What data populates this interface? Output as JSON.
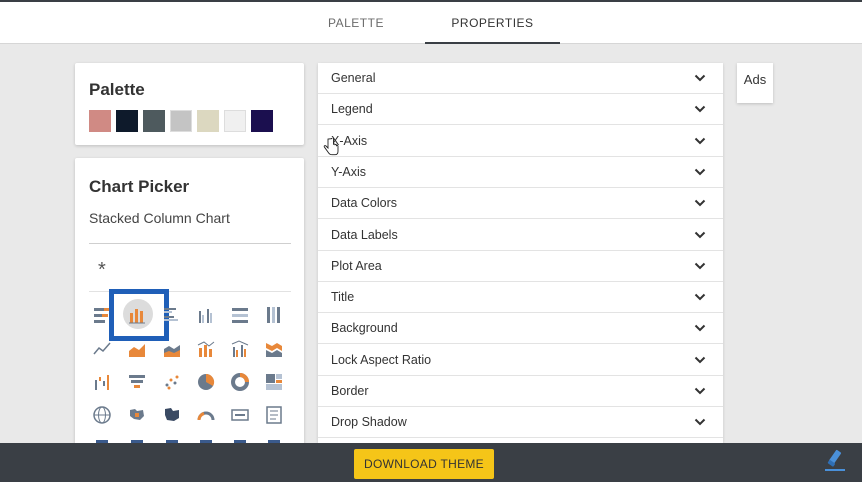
{
  "tabs": [
    {
      "label": "PALETTE",
      "active": false
    },
    {
      "label": "PROPERTIES",
      "active": true
    }
  ],
  "palette": {
    "title": "Palette",
    "swatches": [
      "#d08a84",
      "#0e1a2b",
      "#4e5a5e",
      "#c4c4c4",
      "#dcd8c0",
      "#f0f0f0",
      "#1b0f4f"
    ]
  },
  "chart_picker": {
    "title": "Chart Picker",
    "selected": "Stacked Column Chart",
    "reset_symbol": "*",
    "icons": [
      "stacked-bar-icon",
      "stacked-column-icon",
      "clustered-bar-icon",
      "clustered-column-icon",
      "percent-bar-icon",
      "percent-column-icon",
      "line-icon",
      "area-icon",
      "stacked-area-icon",
      "line-column-icon",
      "line-clustered-column-icon",
      "ribbon-icon",
      "waterfall-icon",
      "funnel-icon",
      "scatter-icon",
      "pie-icon",
      "donut-icon",
      "treemap-icon",
      "globe-map-icon",
      "filled-map-icon",
      "shape-map-icon",
      "gauge-icon",
      "card-icon",
      "multi-row-card-icon"
    ]
  },
  "properties": [
    {
      "label": "General"
    },
    {
      "label": "Legend"
    },
    {
      "label": "X-Axis"
    },
    {
      "label": "Y-Axis"
    },
    {
      "label": "Data Colors"
    },
    {
      "label": "Data Labels"
    },
    {
      "label": "Plot Area"
    },
    {
      "label": "Title"
    },
    {
      "label": "Background"
    },
    {
      "label": "Lock Aspect Ratio"
    },
    {
      "label": "Border"
    },
    {
      "label": "Drop Shadow"
    }
  ],
  "ads_label": "Ads",
  "download_label": "DOWNLOAD THEME",
  "colors": {
    "accent_yellow": "#f5c518",
    "dark_bar": "#3a3f45",
    "selection_blue": "#1f5fb8",
    "icon_orange": "#e8883a"
  }
}
